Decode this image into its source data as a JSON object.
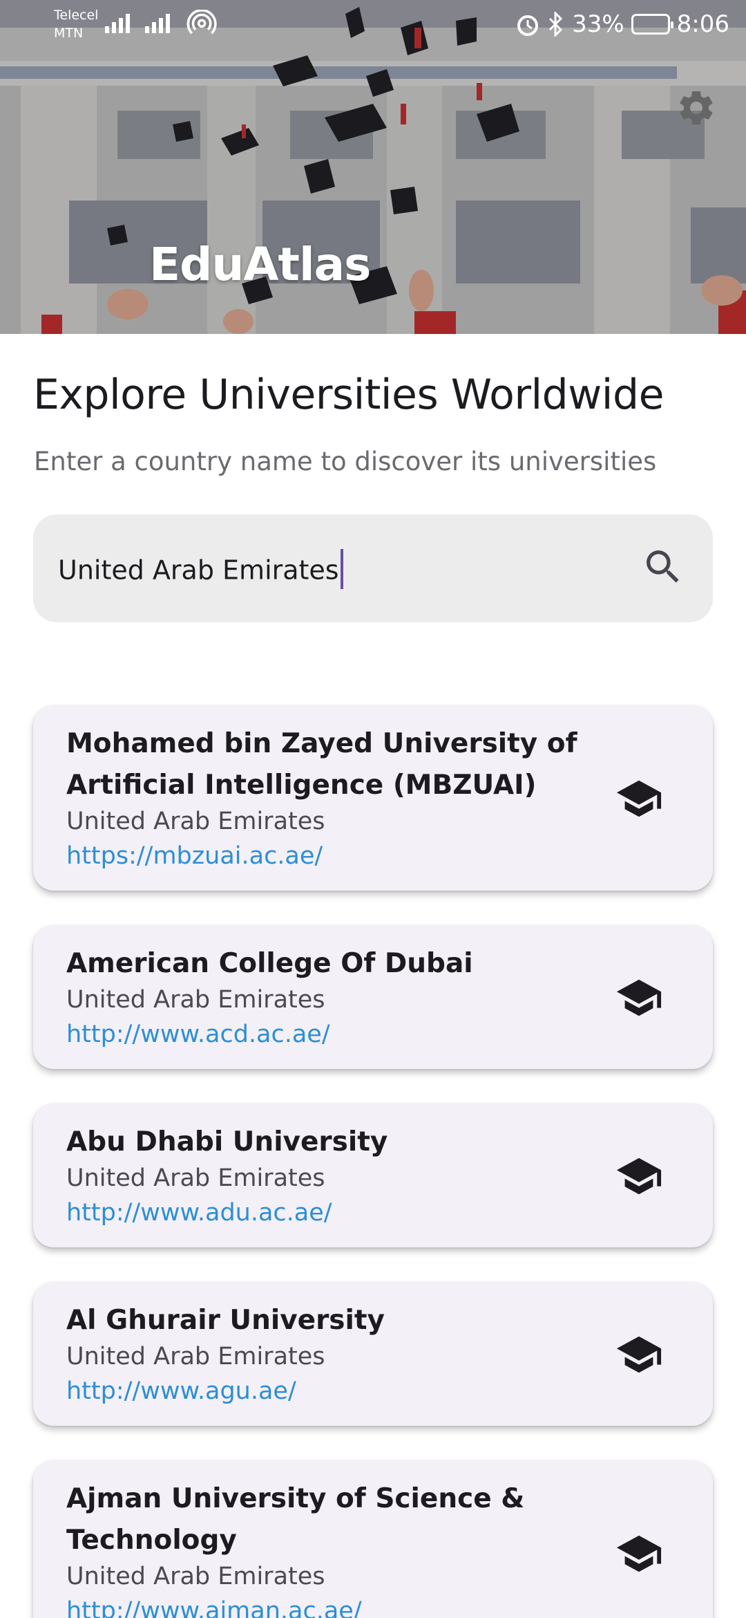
{
  "status": {
    "carrier1": "Telecel",
    "carrier2": "MTN",
    "battery": "33%",
    "time": "8:06"
  },
  "app": {
    "title": "EduAtlas",
    "settings_icon": "gear-icon"
  },
  "main": {
    "heading": "Explore Universities Worldwide",
    "subheading": "Enter a country name to discover its universities"
  },
  "search": {
    "value": "United Arab Emirates",
    "icon": "search-icon"
  },
  "universities": [
    {
      "name": "Mohamed bin Zayed University of Artificial Intelligence (MBZUAI)",
      "country": "United Arab Emirates",
      "url": "https://mbzuai.ac.ae/",
      "icon": "graduation-cap-icon"
    },
    {
      "name": "American College Of Dubai",
      "country": "United Arab Emirates",
      "url": "http://www.acd.ac.ae/",
      "icon": "graduation-cap-icon"
    },
    {
      "name": "Abu Dhabi University",
      "country": "United Arab Emirates",
      "url": "http://www.adu.ac.ae/",
      "icon": "graduation-cap-icon"
    },
    {
      "name": "Al Ghurair University",
      "country": "United Arab Emirates",
      "url": "http://www.agu.ae/",
      "icon": "graduation-cap-icon"
    },
    {
      "name": "Ajman University of Science & Technology",
      "country": "United Arab Emirates",
      "url": "http://www.ajman.ac.ae/",
      "icon": "graduation-cap-icon"
    }
  ]
}
